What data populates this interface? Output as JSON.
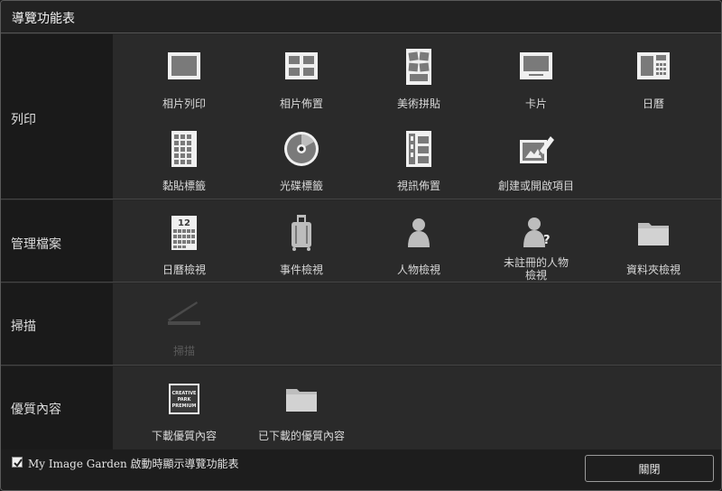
{
  "window": {
    "title": "導覽功能表"
  },
  "sections": [
    {
      "label": "列印",
      "items": [
        {
          "label": "相片列印",
          "icon": "photo-print-icon"
        },
        {
          "label": "相片佈置",
          "icon": "photo-layout-icon"
        },
        {
          "label": "美術拼貼",
          "icon": "collage-icon"
        },
        {
          "label": "卡片",
          "icon": "card-icon"
        },
        {
          "label": "日曆",
          "icon": "calendar-icon"
        },
        {
          "label": "黏貼標籤",
          "icon": "sticker-icon"
        },
        {
          "label": "光碟標籤",
          "icon": "disc-label-icon"
        },
        {
          "label": "視訊佈置",
          "icon": "video-layout-icon"
        },
        {
          "label": "創建或開啟項目",
          "icon": "create-open-item-icon"
        }
      ]
    },
    {
      "label": "管理檔案",
      "items": [
        {
          "label": "日曆檢視",
          "icon": "calendar-view-icon"
        },
        {
          "label": "事件檢視",
          "icon": "event-view-icon"
        },
        {
          "label": "人物檢視",
          "icon": "person-view-icon"
        },
        {
          "label": "未註冊的人物\n檢視",
          "icon": "unregistered-person-icon"
        },
        {
          "label": "資料夾檢視",
          "icon": "folder-view-icon"
        }
      ]
    },
    {
      "label": "掃描",
      "items": [
        {
          "label": "掃描",
          "icon": "scanner-icon",
          "disabled": true
        }
      ]
    },
    {
      "label": "優質內容",
      "items": [
        {
          "label": "下載優質內容",
          "icon": "creative-park-premium-icon",
          "logo_text": [
            "CREATIVE",
            "PARK",
            "PREMIUM"
          ]
        },
        {
          "label": "已下載的優質內容",
          "icon": "downloaded-folder-icon"
        }
      ]
    }
  ],
  "footer": {
    "show_on_startup_label": "My Image Garden 啟動時顯示導覽功能表",
    "show_on_startup_checked": true,
    "close_label": "關閉"
  }
}
